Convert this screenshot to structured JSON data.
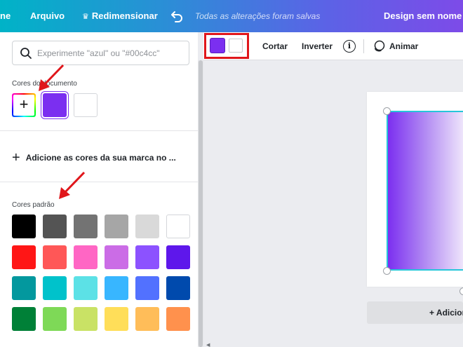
{
  "topbar": {
    "menu_partial": "ne",
    "file_label": "Arquivo",
    "resize_label": "Redimensionar",
    "saved_status": "Todas as alterações foram salvas",
    "design_title": "Design sem nome - L"
  },
  "search": {
    "placeholder": "Experimente \"azul\" ou \"#00c4cc\""
  },
  "document_colors": {
    "heading": "Cores do documento",
    "swatches": [
      "#7b2ff0",
      "#ffffff"
    ]
  },
  "brand_prompt": "Adicione as cores da sua marca no ...",
  "default_colors": {
    "heading": "Cores padrão",
    "rows": [
      [
        "#000000",
        "#545454",
        "#737373",
        "#a6a6a6",
        "#d9d9d9",
        "#ffffff"
      ],
      [
        "#ff1616",
        "#ff5757",
        "#ff66c4",
        "#cb6ce6",
        "#8c52ff",
        "#5e17eb"
      ],
      [
        "#03989e",
        "#00c2cb",
        "#5ce1e6",
        "#38b6ff",
        "#5271ff",
        "#004aad"
      ],
      [
        "#008037",
        "#7ed957",
        "#c9e265",
        "#ffde59",
        "#ffbd59",
        "#ff914d"
      ]
    ]
  },
  "toolbar": {
    "color1": "#7b2ff0",
    "color2": "#ffffff",
    "crop_label": "Cortar",
    "flip_label": "Inverter",
    "info_glyph": "i",
    "animate_label": "Animar"
  },
  "canvas": {
    "add_page_label": "+ Adicion"
  },
  "colors": {
    "accent_red": "#e0161b",
    "selection_cyan": "#26c6d9"
  }
}
